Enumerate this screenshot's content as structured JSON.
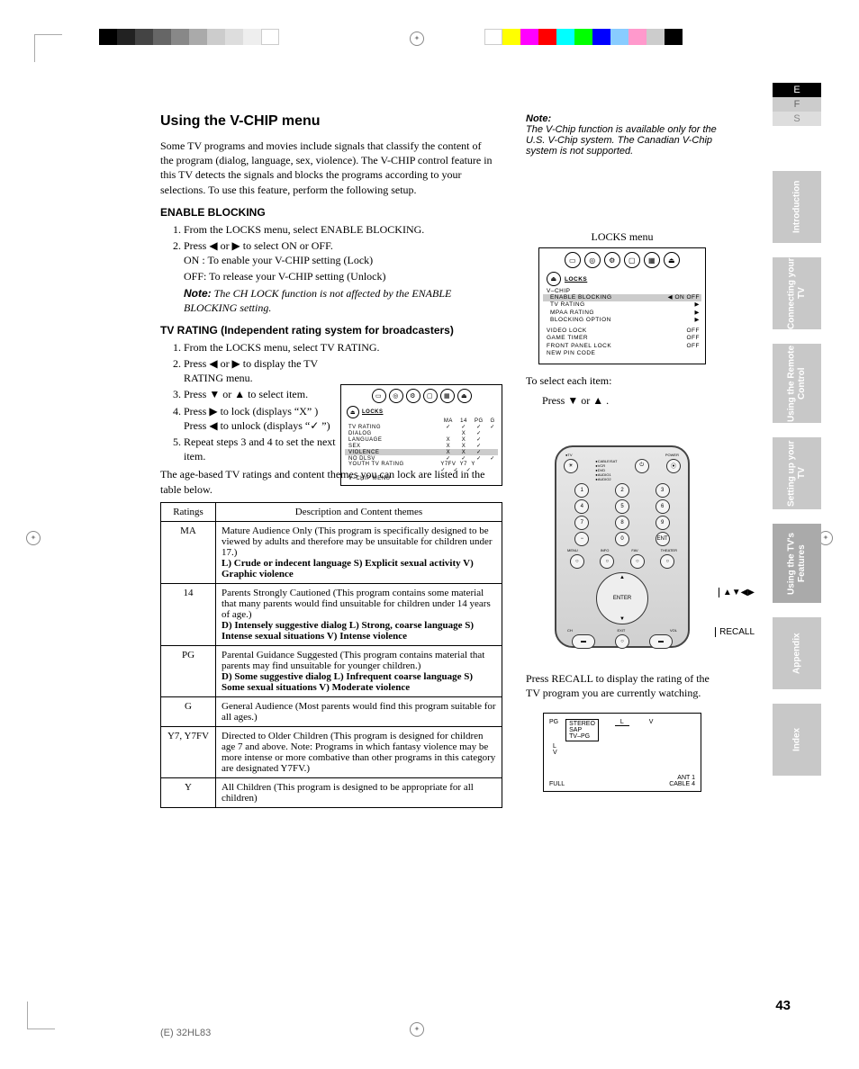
{
  "lang_tabs": {
    "e": "E",
    "f": "F",
    "s": "S"
  },
  "sidebar": [
    "Introduction",
    "Connecting your TV",
    "Using the Remote Control",
    "Setting up your TV",
    "Using the TV's Features",
    "Appendix",
    "Index"
  ],
  "title": "Using the V-CHIP menu",
  "intro": "Some TV programs and movies include signals that classify the content of the program (dialog, language, sex, violence). The V-CHIP control feature in this TV detects the signals and blocks the programs according to your selections. To use this feature, perform the following setup.",
  "enable_heading": "ENABLE BLOCKING",
  "enable_steps": {
    "s1": "From the LOCKS menu, select ENABLE BLOCKING.",
    "s2": "Press ◀ or ▶ to select ON or OFF.",
    "s2a": "ON : To enable your V-CHIP setting (Lock)",
    "s2b": "OFF: To release your V-CHIP setting (Unlock)",
    "note_label": "Note:",
    "note": "The CH LOCK function is not affected by the ENABLE BLOCKING setting."
  },
  "tvrating_heading": "TV RATING (Independent rating system for broadcasters)",
  "tvrating_steps": {
    "s1": "From the LOCKS menu, select TV RATING.",
    "s2": "Press ◀ or ▶ to display the TV RATING menu.",
    "s3": "Press ▼ or ▲ to select item.",
    "s4a": "Press ▶ to lock (displays “X” )",
    "s4b": "Press ◀ to unlock (displays “✓ ”)",
    "s5": "Repeat steps 3 and 4 to set the next item."
  },
  "table_intro": "The age-based TV ratings and content themes you can lock are listed in the table below.",
  "table": {
    "h1": "Ratings",
    "h2": "Description and Content themes",
    "rows": [
      {
        "r": "MA",
        "d": "Mature Audience Only (This program is specifically designed to be viewed by adults and therefore may be unsuitable for children under 17.)",
        "b": "L) Crude or indecent language  S) Explicit sexual activity  V) Graphic violence"
      },
      {
        "r": "14",
        "d": "Parents Strongly Cautioned (This program contains some material that many parents would find unsuitable for children under 14 years of age.)",
        "b": "D) Intensely suggestive dialog  L) Strong, coarse language  S) Intense sexual situations  V) Intense violence"
      },
      {
        "r": "PG",
        "d": "Parental Guidance Suggested (This program contains material that parents may find unsuitable for younger children.)",
        "b": "D) Some suggestive dialog  L) Infrequent coarse language  S) Some sexual situations  V) Moderate violence"
      },
      {
        "r": "G",
        "d": "General Audience (Most parents would find this program suitable for all ages.)",
        "b": ""
      },
      {
        "r": "Y7, Y7FV",
        "d": "Directed to Older Children (This program is designed for children age 7 and above. Note: Programs in which fantasy violence may be more intense or more combative than other programs in this category are designated Y7FV.)",
        "b": ""
      },
      {
        "r": "Y",
        "d": "All Children (This program is designed to be appropriate for all children)",
        "b": ""
      }
    ]
  },
  "right_note": {
    "label": "Note:",
    "text": "The V-Chip function is available only for the U.S. V-Chip system. The Canadian V-Chip system is not supported."
  },
  "locks_caption": "LOCKS menu",
  "locks_menu": {
    "title": "LOCKS",
    "section": "V–CHIP",
    "items": [
      {
        "l": "ENABLE BLOCKING",
        "r": "ON OFF",
        "hl": true,
        "arrow": true
      },
      {
        "l": "TV RATING",
        "r": "▶"
      },
      {
        "l": "MPAA RATING",
        "r": "▶"
      },
      {
        "l": "BLOCKING OPTION",
        "r": "▶"
      }
    ],
    "items2": [
      {
        "l": "VIDEO LOCK",
        "r": "OFF"
      },
      {
        "l": "GAME TIMER",
        "r": "OFF"
      },
      {
        "l": "FRONT PANEL LOCK",
        "r": "OFF"
      },
      {
        "l": "NEW PIN CODE",
        "r": ""
      }
    ]
  },
  "select_text": "To select each item:",
  "select_press": "Press ▼ or ▲ .",
  "tv_rating_box": {
    "title": "LOCKS",
    "cols": [
      "MA",
      "14",
      "PG",
      "G"
    ],
    "rows": [
      {
        "l": "TV RATING",
        "v": [
          "✓",
          "✓",
          "✓",
          "✓"
        ]
      },
      {
        "l": "DIALOG",
        "v": [
          "",
          "X",
          "✓",
          ""
        ]
      },
      {
        "l": "LANGUAGE",
        "v": [
          "X",
          "X",
          "✓",
          ""
        ]
      },
      {
        "l": "SEX",
        "v": [
          "X",
          "X",
          "✓",
          ""
        ]
      },
      {
        "l": "VIOLENCE",
        "v": [
          "X",
          "X",
          "✓",
          ""
        ],
        "hl": true
      },
      {
        "l": "NO DLSV",
        "v": [
          "✓",
          "✓",
          "✓",
          "✓"
        ]
      }
    ],
    "youth_label": "YOUTH TV RATING",
    "youth_cols": [
      "Y7FV",
      "Y7",
      "Y"
    ],
    "youth_vals": [
      "✓",
      "✓",
      "✓"
    ],
    "footer": "V–CHIP MENU"
  },
  "remote_labels": {
    "arrows": "▲▼◀▶",
    "recall": "RECALL",
    "enter": "ENTER"
  },
  "press_recall": "Press RECALL to display the rating of the TV program you are currently watching.",
  "osd": {
    "pg": "PG",
    "stereo": "STEREO",
    "sap": "SAP",
    "tvpg": "TV–PG",
    "l": "L",
    "v": "V",
    "full": "FULL",
    "ant": "ANT   1",
    "cable": "CABLE       4"
  },
  "page_num": "43",
  "footer_code": "(E) 32HL83"
}
